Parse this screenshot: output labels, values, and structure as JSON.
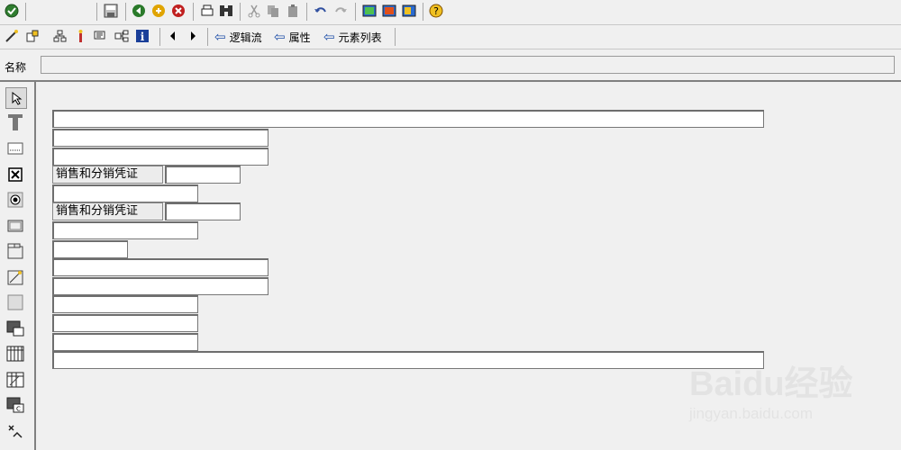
{
  "toolbar": {
    "nav": [
      {
        "label": "逻辑流"
      },
      {
        "label": "属性"
      },
      {
        "label": "元素列表"
      }
    ]
  },
  "name": {
    "label": "名称",
    "value": ""
  },
  "form": {
    "label_1": "销售和分销凭证",
    "label_2": "销售和分销凭证"
  },
  "watermark": {
    "logo": "Baidu经验",
    "url": "jingyan.baidu.com"
  }
}
